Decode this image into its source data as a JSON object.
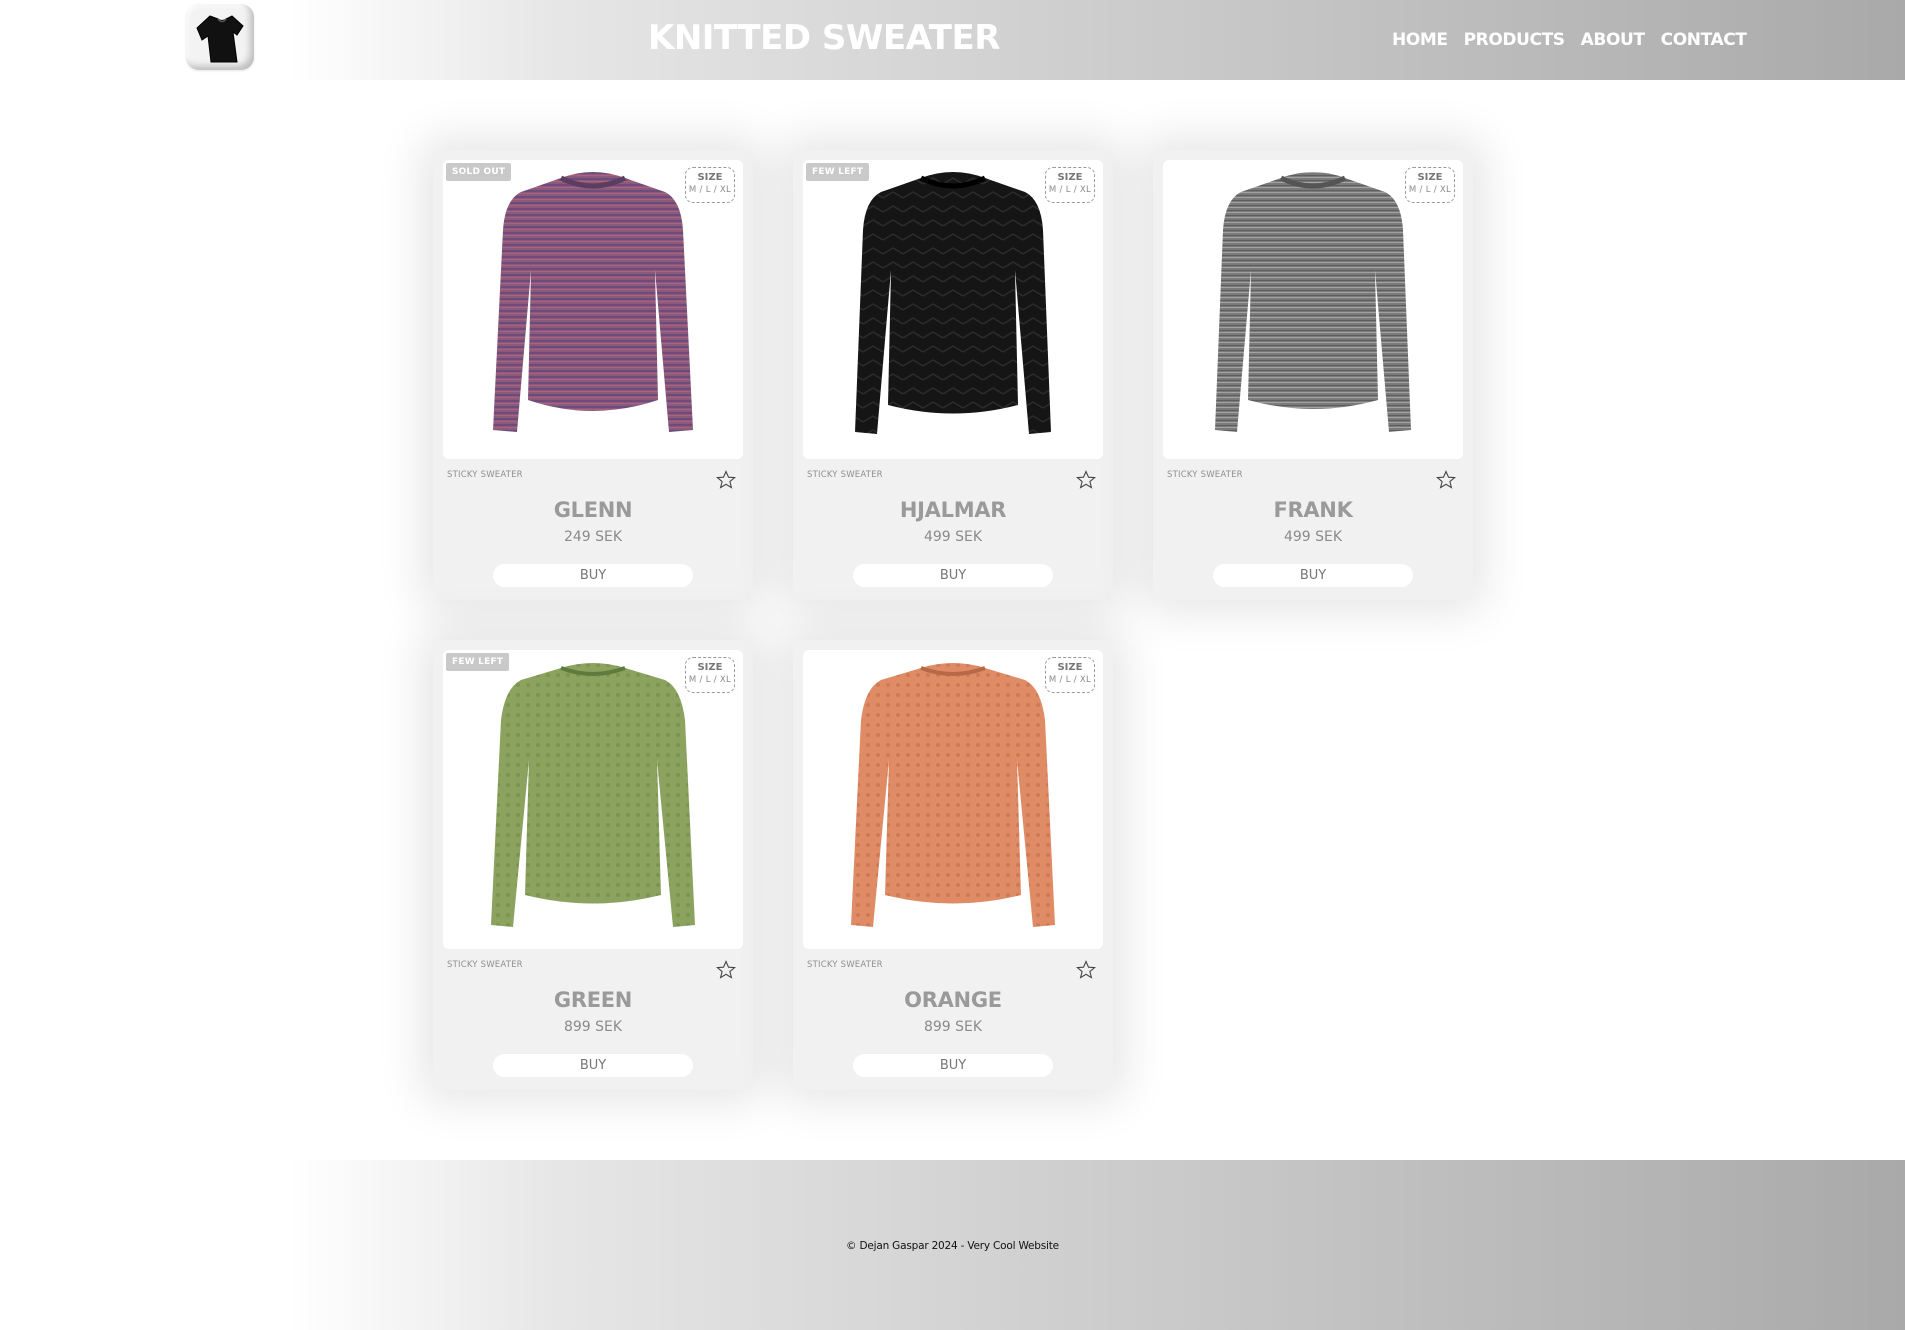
{
  "header": {
    "logo_icon": "tshirt-icon",
    "title": "KNITTED SWEATER",
    "nav": [
      "HOME",
      "PRODUCTS",
      "ABOUT",
      "CONTACT"
    ]
  },
  "size_tag": {
    "title": "SIZE",
    "options": "M / L / XL"
  },
  "products": [
    {
      "badge": "SOLD OUT",
      "brand": "STICKY SWEATER",
      "name": "GLENN",
      "price": "249 SEK",
      "buy": "BUY",
      "color": "#8a5a7a"
    },
    {
      "badge": "FEW LEFT",
      "brand": "STICKY SWEATER",
      "name": "HJALMAR",
      "price": "499 SEK",
      "buy": "BUY",
      "color": "#151515"
    },
    {
      "badge": "",
      "brand": "STICKY SWEATER",
      "name": "FRANK",
      "price": "499 SEK",
      "buy": "BUY",
      "color": "#7a7a7a"
    },
    {
      "badge": "FEW LEFT",
      "brand": "STICKY SWEATER",
      "name": "GREEN",
      "price": "899 SEK",
      "buy": "BUY",
      "color": "#8ba35e"
    },
    {
      "badge": "",
      "brand": "STICKY SWEATER",
      "name": "ORANGE",
      "price": "899 SEK",
      "buy": "BUY",
      "color": "#df8c66"
    }
  ],
  "footer": {
    "text": "© Dejan Gaspar 2024 - Very Cool Website"
  }
}
